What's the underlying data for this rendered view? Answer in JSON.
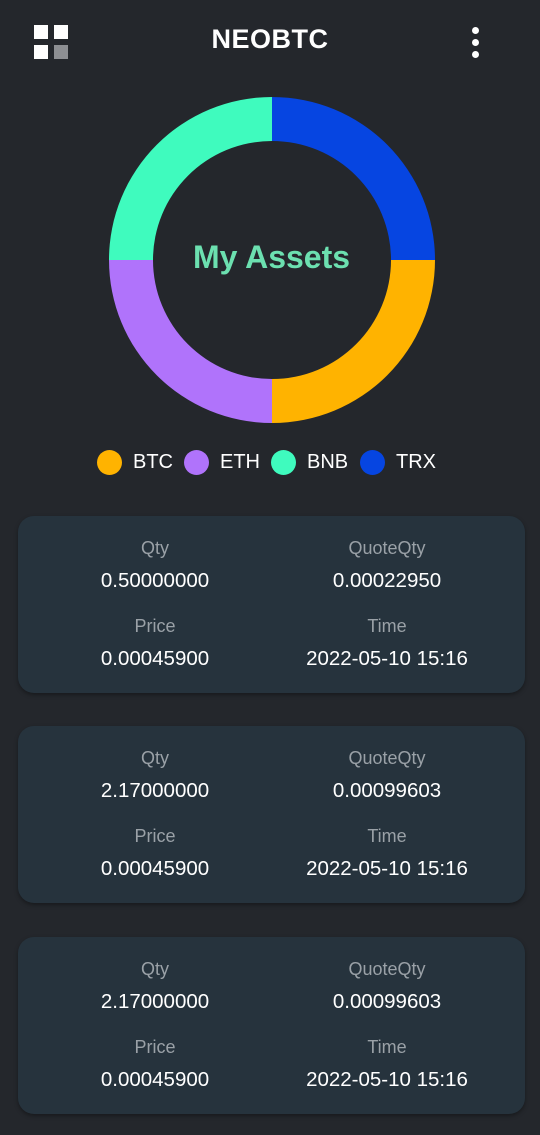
{
  "header": {
    "title": "NEOBTC",
    "menu_icon": "grid-icon",
    "more_icon": "more-vert-icon"
  },
  "chart_data": {
    "type": "pie",
    "style": "donut",
    "center_label": "My Assets",
    "categories": [
      "BTC",
      "ETH",
      "BNB",
      "TRX"
    ],
    "values": [
      25,
      25,
      25,
      25
    ],
    "colors": [
      "#ffb300",
      "#b073fb",
      "#3ffbbe",
      "#0645e1"
    ],
    "legend": "bottom"
  },
  "trades": [
    {
      "qty_label": "Qty",
      "qty": "0.50000000",
      "quoteqty_label": "QuoteQty",
      "quoteqty": "0.00022950",
      "price_label": "Price",
      "price": "0.00045900",
      "time_label": "Time",
      "time": "2022-05-10 15:16"
    },
    {
      "qty_label": "Qty",
      "qty": "2.17000000",
      "quoteqty_label": "QuoteQty",
      "quoteqty": "0.00099603",
      "price_label": "Price",
      "price": "0.00045900",
      "time_label": "Time",
      "time": "2022-05-10 15:16"
    },
    {
      "qty_label": "Qty",
      "qty": "2.17000000",
      "quoteqty_label": "QuoteQty",
      "quoteqty": "0.00099603",
      "price_label": "Price",
      "price": "0.00045900",
      "time_label": "Time",
      "time": "2022-05-10 15:16"
    }
  ]
}
